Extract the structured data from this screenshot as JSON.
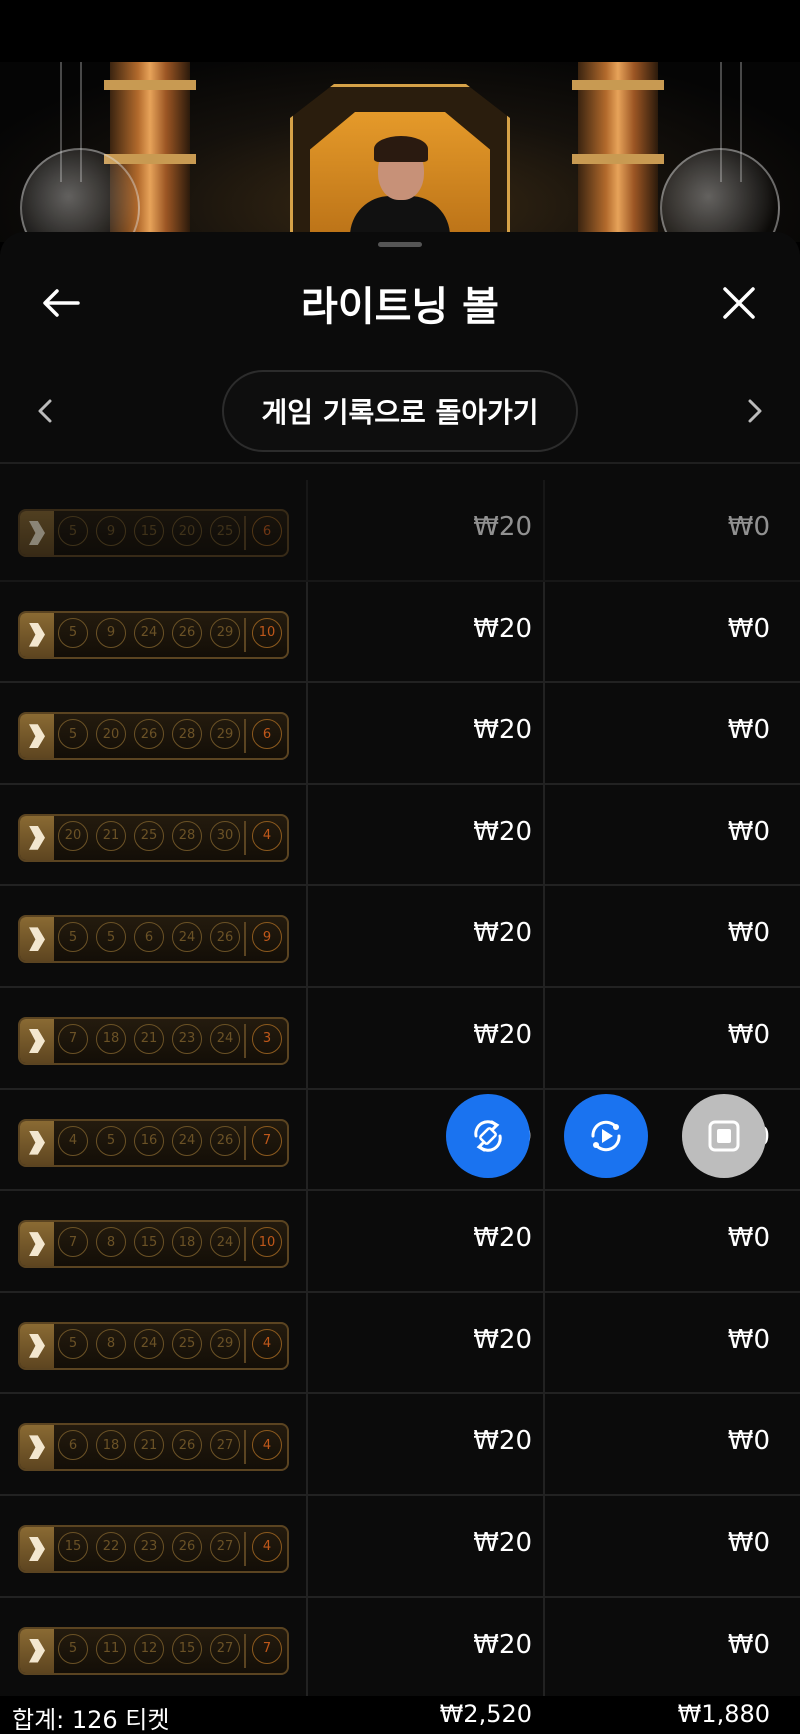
{
  "header": {
    "title": "라이트닝 볼"
  },
  "pager": {
    "label": "게임 기록으로 돌아가기"
  },
  "tickets": [
    {
      "balls": [
        "5",
        "9",
        "15",
        "20",
        "25"
      ],
      "lightning": "6",
      "bet": "₩20",
      "win": "₩0"
    },
    {
      "balls": [
        "5",
        "9",
        "24",
        "26",
        "29"
      ],
      "lightning": "10",
      "bet": "₩20",
      "win": "₩0"
    },
    {
      "balls": [
        "5",
        "20",
        "26",
        "28",
        "29"
      ],
      "lightning": "6",
      "bet": "₩20",
      "win": "₩0"
    },
    {
      "balls": [
        "20",
        "21",
        "25",
        "28",
        "30"
      ],
      "lightning": "4",
      "bet": "₩20",
      "win": "₩0"
    },
    {
      "balls": [
        "5",
        "5",
        "6",
        "24",
        "26"
      ],
      "lightning": "9",
      "bet": "₩20",
      "win": "₩0"
    },
    {
      "balls": [
        "7",
        "18",
        "21",
        "23",
        "24"
      ],
      "lightning": "3",
      "bet": "₩20",
      "win": "₩0"
    },
    {
      "balls": [
        "4",
        "5",
        "16",
        "24",
        "26"
      ],
      "lightning": "7",
      "bet": "₩20",
      "win": "₩0"
    },
    {
      "balls": [
        "7",
        "8",
        "15",
        "18",
        "24"
      ],
      "lightning": "10",
      "bet": "₩20",
      "win": "₩0"
    },
    {
      "balls": [
        "5",
        "8",
        "24",
        "25",
        "29"
      ],
      "lightning": "4",
      "bet": "₩20",
      "win": "₩0"
    },
    {
      "balls": [
        "6",
        "18",
        "21",
        "26",
        "27"
      ],
      "lightning": "4",
      "bet": "₩20",
      "win": "₩0"
    },
    {
      "balls": [
        "15",
        "22",
        "23",
        "26",
        "27"
      ],
      "lightning": "4",
      "bet": "₩20",
      "win": "₩0"
    },
    {
      "balls": [
        "5",
        "11",
        "12",
        "15",
        "27"
      ],
      "lightning": "7",
      "bet": "₩20",
      "win": "₩0"
    }
  ],
  "footer": {
    "label": "합계: 126 티켓",
    "total_bet": "₩2,520",
    "total_win": "₩1,880"
  },
  "icons": {
    "back": "arrow-left-icon",
    "close": "close-icon",
    "prev": "chevron-left-icon",
    "next": "chevron-right-icon",
    "rotate": "rotate-screen-icon",
    "replay": "replay-icon",
    "stop": "stop-icon"
  },
  "colors": {
    "background": "#0b0b0b",
    "fab_blue": "#1a73f0",
    "fab_gray": "#bdbdbd",
    "ticket_gold": "#5b4421",
    "lightning_orange": "#c0581a"
  }
}
